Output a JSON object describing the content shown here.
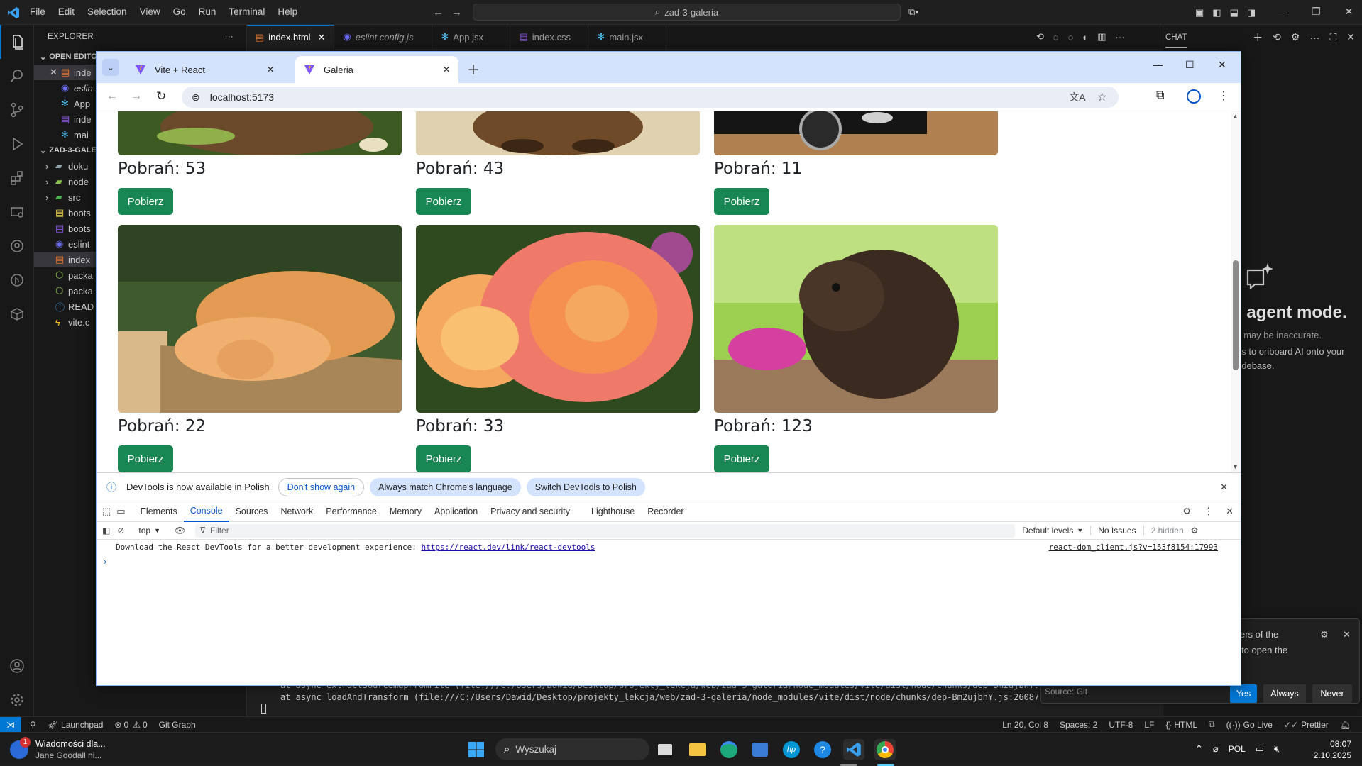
{
  "vscode": {
    "menu": [
      "File",
      "Edit",
      "Selection",
      "View",
      "Go",
      "Run",
      "Terminal",
      "Help"
    ],
    "command_center": "zad-3-galeria",
    "explorer_title": "EXPLORER",
    "open_editors_label": "OPEN EDITORS",
    "open_editors": [
      "inde",
      "eslin",
      "App",
      "inde",
      "mai"
    ],
    "project_label": "ZAD-3-GALE",
    "tree": [
      "doku",
      "node",
      "src",
      "boots",
      "boots",
      "eslint",
      "index",
      "packa",
      "packa",
      "READ",
      "vite.c"
    ],
    "tabs": [
      "index.html",
      "eslint.config.js",
      "App.jsx",
      "index.css",
      "main.jsx"
    ],
    "chat_title": "CHAT",
    "chat_heading": "n agent mode.",
    "chat_lines": [
      "s may be inaccurate.",
      "ns to onboard AI onto your",
      "odebase."
    ],
    "terminal_lines": [
      "at async extractSourcemapFromFile (file:///C:/Users/Dawid/Desktop/projekty_lekcja/web/zad-3-galeria/node_modules/vite/dist/node/chunks/dep-Bm2ujbhY.js:8",
      "at async loadAndTransform (file:///C:/Users/Dawid/Desktop/projekty_lekcja/web/zad-3-galeria/node_modules/vite/dist/node/chunks/dep-Bm2ujbhY.js:26087:22)"
    ],
    "notification": {
      "text1": "ers of the",
      "text2": "to open the",
      "source": "Source: Git",
      "yes": "Yes",
      "always": "Always",
      "never": "Never"
    },
    "status": {
      "launchpad": "Launchpad",
      "errors": "0",
      "warnings": "0",
      "git_graph": "Git Graph",
      "position": "Ln 20, Col 8",
      "spaces": "Spaces: 2",
      "encoding": "UTF-8",
      "eol": "LF",
      "language": "HTML",
      "golive": "Go Live",
      "prettier": "Prettier"
    }
  },
  "chrome": {
    "tabs": [
      {
        "title": "Vite + React",
        "active": false
      },
      {
        "title": "Galeria",
        "active": true
      }
    ],
    "url": "localhost:5173",
    "gallery": {
      "button_label": "Pobierz",
      "count_prefix": "Pobrań: ",
      "row1": [
        {
          "downloads": "53",
          "subject": "guinea-pig-on-grass"
        },
        {
          "downloads": "43",
          "subject": "puppy"
        },
        {
          "downloads": "11",
          "subject": "black-car"
        }
      ],
      "row2": [
        {
          "downloads": "22",
          "subject": "sleeping-kittens"
        },
        {
          "downloads": "33",
          "subject": "orange-rose"
        },
        {
          "downloads": "123",
          "subject": "guinea-pig"
        }
      ]
    },
    "devtools": {
      "banner_text": "DevTools is now available in Polish",
      "banner_btn1": "Don't show again",
      "banner_btn2": "Always match Chrome's language",
      "banner_btn3": "Switch DevTools to Polish",
      "tabs": [
        "Elements",
        "Console",
        "Sources",
        "Network",
        "Performance",
        "Memory",
        "Application",
        "Privacy and security",
        "Lighthouse",
        "Recorder"
      ],
      "active_tab": "Console",
      "context": "top",
      "filter_placeholder": "Filter",
      "levels": "Default levels",
      "issues": "No Issues",
      "hidden": "2 hidden",
      "message": "Download the React DevTools for a better development experience: ",
      "message_link": "https://react.dev/link/react-devtools",
      "source_link": "react-dom_client.js?v=153f8154:17993"
    }
  },
  "taskbar": {
    "news_title": "Wiadomości dla...",
    "news_sub": "Jane Goodall ni...",
    "news_badge": "1",
    "search_placeholder": "Wyszukaj",
    "lang": "POL",
    "time": "08:07",
    "date": "2.10.2025"
  },
  "colors": {
    "vscode_bg": "#1f1f1f",
    "chrome_tabstrip": "#d3e3fd",
    "button_green": "#198754",
    "accent_blue": "#0078d4"
  }
}
